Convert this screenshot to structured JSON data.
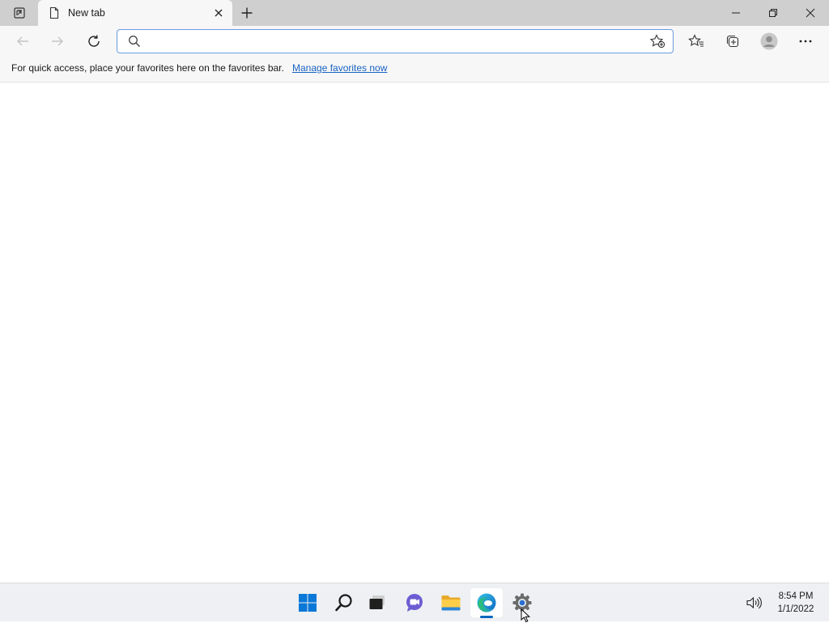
{
  "browser": {
    "tab": {
      "title": "New tab"
    },
    "address_bar": {
      "value": "",
      "placeholder": ""
    },
    "favorites_bar": {
      "message": "For quick access, place your favorites here on the favorites bar.",
      "link_label": "Manage favorites now"
    }
  },
  "taskbar": {
    "apps": [
      {
        "name": "start",
        "icon": "windows-logo-icon"
      },
      {
        "name": "search",
        "icon": "search-icon"
      },
      {
        "name": "task-view",
        "icon": "task-view-icon"
      },
      {
        "name": "chat",
        "icon": "chat-icon"
      },
      {
        "name": "file-explorer",
        "icon": "folder-icon"
      },
      {
        "name": "edge",
        "icon": "edge-icon",
        "active": true
      },
      {
        "name": "settings",
        "icon": "gear-icon"
      }
    ],
    "clock": {
      "time": "8:54 PM",
      "date": "1/1/2022"
    }
  },
  "colors": {
    "accent": "#0067c0",
    "link": "#1a63c2",
    "tabstrip_bg": "#cfcfcf",
    "toolbar_bg": "#f7f7f7",
    "taskbar_bg": "#eef0f3"
  }
}
